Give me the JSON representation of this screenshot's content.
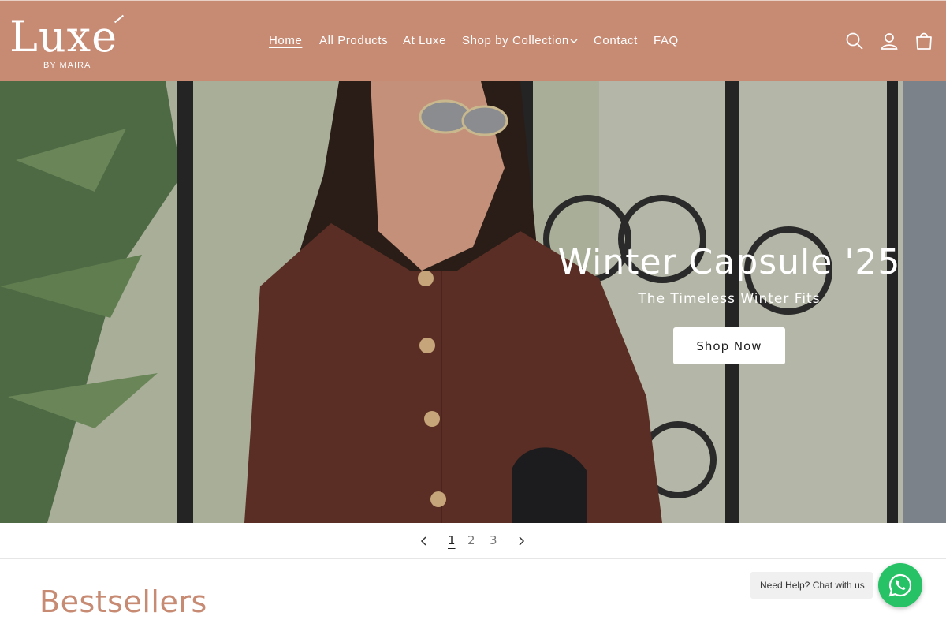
{
  "brand": {
    "logo_word": "Luxe",
    "logo_sub": "BY MAIRA"
  },
  "nav": {
    "items": [
      {
        "label": "Home",
        "active": true
      },
      {
        "label": "All Products"
      },
      {
        "label": "At Luxe"
      },
      {
        "label": "Shop by Collection",
        "has_dropdown": true
      },
      {
        "label": "Contact"
      },
      {
        "label": "FAQ"
      }
    ]
  },
  "header_icons": [
    "search-icon",
    "account-icon",
    "cart-icon"
  ],
  "hero": {
    "title": "Winter Capsule '25",
    "subtitle": "The Timeless Winter Fits",
    "cta_label": "Shop Now"
  },
  "slider": {
    "pages": [
      "1",
      "2",
      "3"
    ],
    "current_page": "1"
  },
  "bestsellers": {
    "title": "Bestsellers"
  },
  "chat": {
    "label": "Need Help? Chat with us",
    "icon": "whatsapp-icon"
  },
  "colors": {
    "brand": "#c78a73",
    "chat_green": "#26c265",
    "button_bg": "#ffffff"
  }
}
